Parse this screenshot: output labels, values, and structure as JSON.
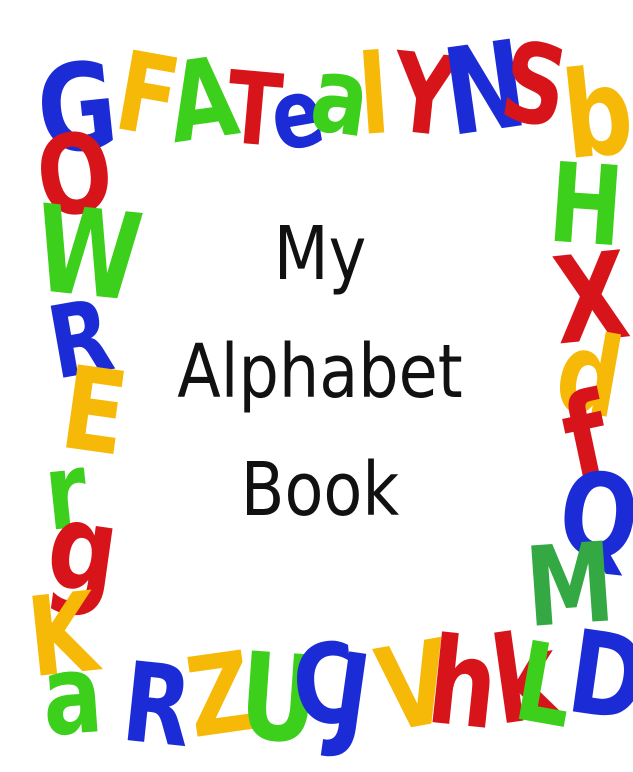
{
  "title": {
    "line1": "My",
    "line2": "Alphabet",
    "line3": "Book"
  },
  "palette": {
    "blue": "#1b2bd6",
    "red": "#d8141b",
    "green": "#3ccf1b",
    "yellow": "#f7b908",
    "dark_green": "#33a843"
  },
  "border_letters": {
    "top": [
      {
        "char": "G",
        "color": "blue"
      },
      {
        "char": "F",
        "color": "yellow"
      },
      {
        "char": "A",
        "color": "green"
      },
      {
        "char": "T",
        "color": "red"
      },
      {
        "char": "e",
        "color": "blue"
      },
      {
        "char": "a",
        "color": "green"
      },
      {
        "char": "l",
        "color": "yellow"
      },
      {
        "char": "Y",
        "color": "red"
      },
      {
        "char": "N",
        "color": "blue"
      },
      {
        "char": "S",
        "color": "red"
      },
      {
        "char": "b",
        "color": "yellow"
      }
    ],
    "left": [
      {
        "char": "O",
        "color": "red"
      },
      {
        "char": "W",
        "color": "green"
      },
      {
        "char": "R",
        "color": "blue"
      },
      {
        "char": "E",
        "color": "yellow"
      },
      {
        "char": "r",
        "color": "green"
      },
      {
        "char": "g",
        "color": "red"
      },
      {
        "char": "K",
        "color": "yellow"
      }
    ],
    "right": [
      {
        "char": "H",
        "color": "green"
      },
      {
        "char": "X",
        "color": "red"
      },
      {
        "char": "d",
        "color": "yellow"
      },
      {
        "char": "f",
        "color": "red"
      },
      {
        "char": "Q",
        "color": "blue"
      },
      {
        "char": "M",
        "color": "dark_green"
      },
      {
        "char": "D",
        "color": "blue"
      }
    ],
    "bottom": [
      {
        "char": "a",
        "color": "green"
      },
      {
        "char": "R",
        "color": "blue"
      },
      {
        "char": "Z",
        "color": "yellow"
      },
      {
        "char": "U",
        "color": "green"
      },
      {
        "char": "C",
        "color": "blue"
      },
      {
        "char": "J",
        "color": "blue"
      },
      {
        "char": "V",
        "color": "yellow"
      },
      {
        "char": "h",
        "color": "red"
      },
      {
        "char": "k",
        "color": "red"
      },
      {
        "char": "L",
        "color": "green"
      }
    ]
  }
}
